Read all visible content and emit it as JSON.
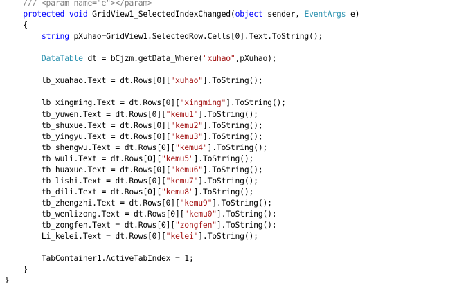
{
  "colors": {
    "keyword": "#0000ff",
    "type": "#2b91af",
    "string": "#a31515",
    "comment": "#808080",
    "text": "#000000",
    "background": "#ffffff"
  },
  "code": [
    [
      {
        "t": "        ",
        "c": "plain"
      },
      {
        "t": "/// <param name=\"e\"></param>",
        "c": "cmt"
      }
    ],
    [
      {
        "t": "        ",
        "c": "plain"
      },
      {
        "t": "protected",
        "c": "kw"
      },
      {
        "t": " ",
        "c": "plain"
      },
      {
        "t": "void",
        "c": "kw"
      },
      {
        "t": " GridView1_SelectedIndexChanged(",
        "c": "plain"
      },
      {
        "t": "object",
        "c": "kw"
      },
      {
        "t": " sender, ",
        "c": "plain"
      },
      {
        "t": "EventArgs",
        "c": "type"
      },
      {
        "t": " e)",
        "c": "plain"
      }
    ],
    [
      {
        "t": "        {",
        "c": "plain"
      }
    ],
    [
      {
        "t": "            ",
        "c": "plain"
      },
      {
        "t": "string",
        "c": "kw"
      },
      {
        "t": " pXuhao=GridView1.SelectedRow.Cells[0].Text.ToString();",
        "c": "plain"
      }
    ],
    [],
    [
      {
        "t": "            ",
        "c": "plain"
      },
      {
        "t": "DataTable",
        "c": "type"
      },
      {
        "t": " dt = bCjzm.getData_Where(",
        "c": "plain"
      },
      {
        "t": "\"xuhao\"",
        "c": "str"
      },
      {
        "t": ",pXuhao);",
        "c": "plain"
      }
    ],
    [],
    [
      {
        "t": "            lb_xuahao.Text = dt.Rows[0][",
        "c": "plain"
      },
      {
        "t": "\"xuhao\"",
        "c": "str"
      },
      {
        "t": "].ToString();",
        "c": "plain"
      }
    ],
    [],
    [
      {
        "t": "            lb_xingming.Text = dt.Rows[0][",
        "c": "plain"
      },
      {
        "t": "\"xingming\"",
        "c": "str"
      },
      {
        "t": "].ToString();",
        "c": "plain"
      }
    ],
    [
      {
        "t": "            tb_yuwen.Text = dt.Rows[0][",
        "c": "plain"
      },
      {
        "t": "\"kemu1\"",
        "c": "str"
      },
      {
        "t": "].ToString();",
        "c": "plain"
      }
    ],
    [
      {
        "t": "            tb_shuxue.Text = dt.Rows[0][",
        "c": "plain"
      },
      {
        "t": "\"kemu2\"",
        "c": "str"
      },
      {
        "t": "].ToString();",
        "c": "plain"
      }
    ],
    [
      {
        "t": "            tb_yingyu.Text = dt.Rows[0][",
        "c": "plain"
      },
      {
        "t": "\"kemu3\"",
        "c": "str"
      },
      {
        "t": "].ToString();",
        "c": "plain"
      }
    ],
    [
      {
        "t": "            tb_shengwu.Text = dt.Rows[0][",
        "c": "plain"
      },
      {
        "t": "\"kemu4\"",
        "c": "str"
      },
      {
        "t": "].ToString();",
        "c": "plain"
      }
    ],
    [
      {
        "t": "            tb_wuli.Text = dt.Rows[0][",
        "c": "plain"
      },
      {
        "t": "\"kemu5\"",
        "c": "str"
      },
      {
        "t": "].ToString();",
        "c": "plain"
      }
    ],
    [
      {
        "t": "            tb_huaxue.Text = dt.Rows[0][",
        "c": "plain"
      },
      {
        "t": "\"kemu6\"",
        "c": "str"
      },
      {
        "t": "].ToString();",
        "c": "plain"
      }
    ],
    [
      {
        "t": "            tb_lishi.Text = dt.Rows[0][",
        "c": "plain"
      },
      {
        "t": "\"kemu7\"",
        "c": "str"
      },
      {
        "t": "].ToString();",
        "c": "plain"
      }
    ],
    [
      {
        "t": "            tb_dili.Text = dt.Rows[0][",
        "c": "plain"
      },
      {
        "t": "\"kemu8\"",
        "c": "str"
      },
      {
        "t": "].ToString();",
        "c": "plain"
      }
    ],
    [
      {
        "t": "            tb_zhengzhi.Text = dt.Rows[0][",
        "c": "plain"
      },
      {
        "t": "\"kemu9\"",
        "c": "str"
      },
      {
        "t": "].ToString();",
        "c": "plain"
      }
    ],
    [
      {
        "t": "            tb_wenlizong.Text = dt.Rows[0][",
        "c": "plain"
      },
      {
        "t": "\"kemu0\"",
        "c": "str"
      },
      {
        "t": "].ToString();",
        "c": "plain"
      }
    ],
    [
      {
        "t": "            tb_zongfen.Text = dt.Rows[0][",
        "c": "plain"
      },
      {
        "t": "\"zongfen\"",
        "c": "str"
      },
      {
        "t": "].ToString();",
        "c": "plain"
      }
    ],
    [
      {
        "t": "            Li_kelei.Text = dt.Rows[0][",
        "c": "plain"
      },
      {
        "t": "\"kelei\"",
        "c": "str"
      },
      {
        "t": "].ToString();",
        "c": "plain"
      }
    ],
    [],
    [
      {
        "t": "            TabContainer1.ActiveTabIndex = 1;",
        "c": "plain"
      }
    ],
    [
      {
        "t": "        }",
        "c": "plain"
      }
    ],
    [
      {
        "t": "    }",
        "c": "plain"
      }
    ]
  ]
}
